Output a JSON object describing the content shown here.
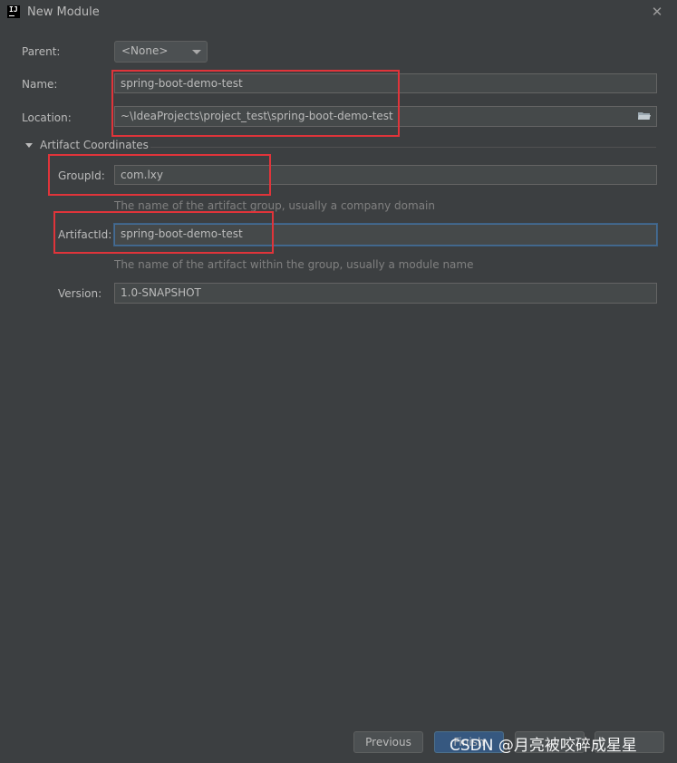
{
  "window": {
    "title": "New Module"
  },
  "parent": {
    "label": "Parent:",
    "value": "<None>"
  },
  "name": {
    "label": "Name:",
    "value": "spring-boot-demo-test"
  },
  "location": {
    "label": "Location:",
    "value": "~\\IdeaProjects\\project_test\\spring-boot-demo-test"
  },
  "artifact_section": {
    "title": "Artifact Coordinates"
  },
  "group_id": {
    "label": "GroupId:",
    "value": "com.lxy",
    "hint": "The name of the artifact group, usually a company domain"
  },
  "artifact_id": {
    "label": "ArtifactId:",
    "value": "spring-boot-demo-test",
    "hint": "The name of the artifact within the group, usually a module name"
  },
  "version": {
    "label": "Version:",
    "value": "1.0-SNAPSHOT"
  },
  "buttons": {
    "previous": "Previous",
    "finish": "Finish"
  },
  "watermark": "CSDN @月亮被咬碎成星星",
  "colors": {
    "annotation": "#e0343a",
    "focus": "#466d94",
    "background": "#3c3f41"
  }
}
